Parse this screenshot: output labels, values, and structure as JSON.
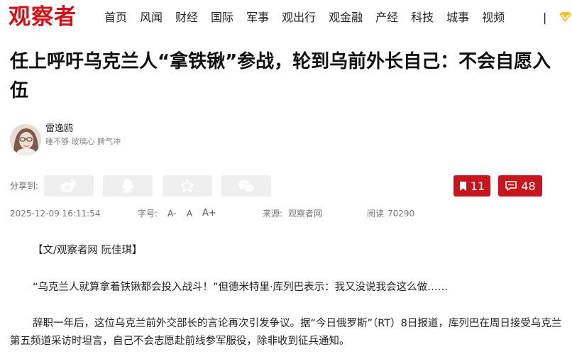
{
  "header": {
    "logo_text": "观察者",
    "nav": [
      "首页",
      "风闻",
      "财经",
      "国际",
      "军事",
      "观出行",
      "观金融",
      "产经",
      "科技",
      "城事",
      "视频"
    ],
    "separator": "|",
    "brand_color": "#d0121b"
  },
  "article": {
    "title": "任上呼吁乌克兰人“拿铁锹”参战，轮到乌前外长自己：不会自愿入伍",
    "author": {
      "name": "雷逸鸥",
      "bio": "睡不够 玻璃心 脾气冲"
    },
    "share_label": "分享到:",
    "share_icons": [
      "weibo-icon",
      "qq-icon",
      "qzone-star-icon",
      "wechat-icon"
    ],
    "bookmark_count": "11",
    "comment_count": "48",
    "accent_color": "#c7161d",
    "date": "2025-12-09 16:11:54",
    "font_size": {
      "label": "字号:",
      "small": "A-",
      "normal": "A",
      "large": "A+"
    },
    "source": {
      "label": "来源:",
      "value": "观察者网"
    },
    "reads": {
      "label": "阅读",
      "value": "70290"
    },
    "paragraphs": [
      "【文/观察者网 阮佳琪】",
      "“乌克兰人就算拿着铁锹都会投入战斗！”但德米特里·库列巴表示：我又没说我会这么做……",
      "辞职一年后，这位乌克兰前外交部长的言论再次引发争议。据“今日俄罗斯”（RT）8日报道，库列巴在周日接受乌克兰第五频道采访时坦言，自己不会志愿赴前线参军服役，除非收到征兵通知。"
    ]
  }
}
